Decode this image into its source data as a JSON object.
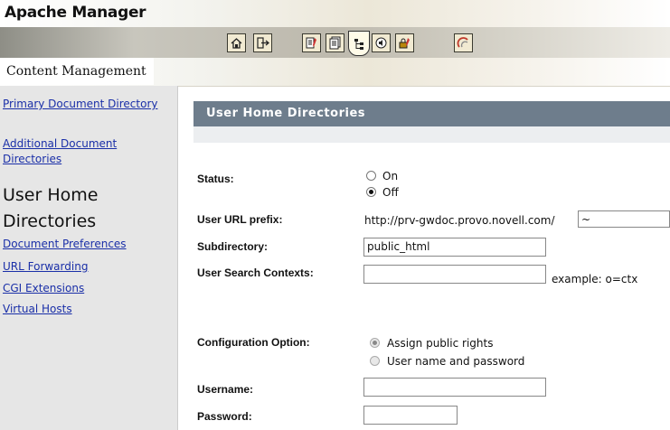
{
  "header": {
    "app_title": "Apache Manager",
    "section_label": "Content Management",
    "toolbar": [
      {
        "icon": "home-icon"
      },
      {
        "icon": "exit-icon"
      },
      {
        "icon": "document-edit-icon"
      },
      {
        "icon": "document-list-icon"
      },
      {
        "icon": "directory-tree-icon"
      },
      {
        "icon": "speaker-icon"
      },
      {
        "icon": "lock-edit-icon"
      },
      {
        "icon": "novell-logo-icon"
      }
    ]
  },
  "sidebar": {
    "links": [
      {
        "label": "Primary Document Directory"
      },
      {
        "label": "Additional Document Directories"
      },
      {
        "label": "Document Preferences"
      },
      {
        "label": "URL Forwarding"
      },
      {
        "label": "CGI Extensions"
      },
      {
        "label": "Virtual Hosts"
      }
    ],
    "current": "User Home Directories"
  },
  "panel": {
    "title": "User Home Directories",
    "status_label": "Status:",
    "status_on": "On",
    "status_off": "Off",
    "status_value": "Off",
    "url_prefix_label": "User URL prefix:",
    "url_prefix_text": "http://prv-gwdoc.provo.novell.com/",
    "url_prefix_value": "~",
    "subdirectory_label": "Subdirectory:",
    "subdirectory_value": "public_html",
    "search_contexts_label": "User Search Contexts:",
    "search_contexts_value": "",
    "search_contexts_hint": "example: o=ctx",
    "config_label": "Configuration Option:",
    "config_opt1": "Assign public rights",
    "config_opt2": "User name and password",
    "config_value": "Assign public rights",
    "username_label": "Username:",
    "username_value": "",
    "password_label": "Password:",
    "password_value": ""
  }
}
